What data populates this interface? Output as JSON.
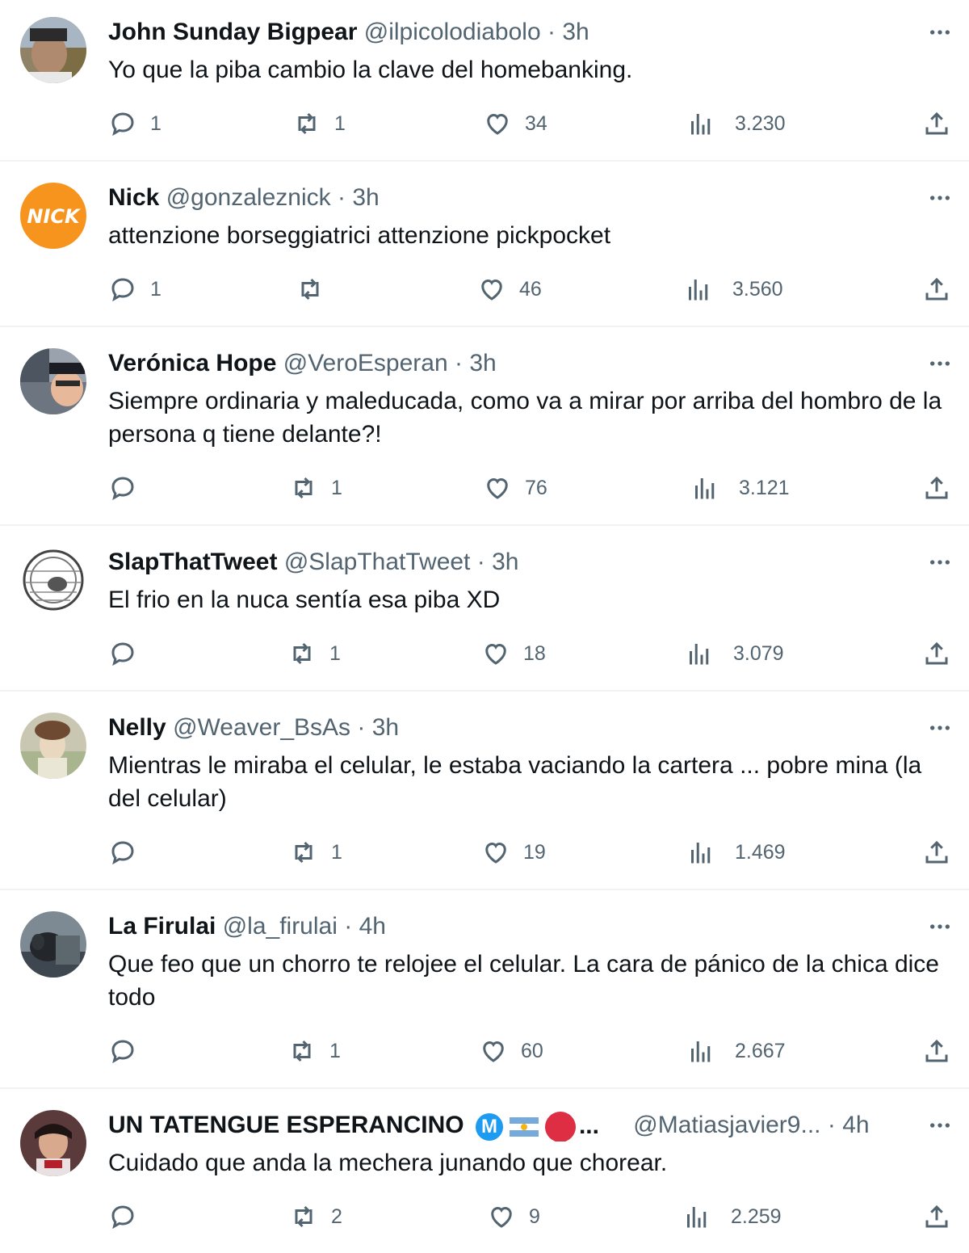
{
  "tweets": [
    {
      "name": "John Sunday Bigpear",
      "handle": "@ilpicolodiabolo",
      "sep": "·",
      "time": "3h",
      "text": "Yo que la piba cambio la clave del homebanking.",
      "replies": "1",
      "retweets": "1",
      "likes": "34",
      "views": "3.230",
      "avatar_icon": "user-photo-avatar"
    },
    {
      "name": "Nick",
      "handle": "@gonzaleznick",
      "sep": "·",
      "time": "3h",
      "text": "attenzione borseggiatrici attenzione pickpocket",
      "replies": "1",
      "retweets": "",
      "likes": "46",
      "views": "3.560",
      "avatar_text": "NICK",
      "avatar_color": "#f7941d"
    },
    {
      "name": "Verónica Hope",
      "handle": "@VeroEsperan",
      "sep": "·",
      "time": "3h",
      "text": "Siempre ordinaria y maleducada, como va a mirar por arriba del hombro de la persona q tiene delante?!",
      "replies": "",
      "retweets": "1",
      "likes": "76",
      "views": "3.121",
      "avatar_icon": "user-photo-avatar"
    },
    {
      "name": "SlapThatTweet",
      "handle": "@SlapThatTweet",
      "sep": "·",
      "time": "3h",
      "text": "El frio en la nuca sentía esa piba XD",
      "replies": "",
      "retweets": "1",
      "likes": "18",
      "views": "3.079",
      "avatar_icon": "hamster-wheel-avatar"
    },
    {
      "name": "Nelly",
      "handle": "@Weaver_BsAs",
      "sep": "·",
      "time": "3h",
      "text": "Mientras le miraba el celular, le estaba vaciando la cartera ... pobre mina (la del celular)",
      "replies": "",
      "retweets": "1",
      "likes": "19",
      "views": "1.469",
      "avatar_icon": "vintage-portrait-avatar"
    },
    {
      "name": "La Firulai",
      "handle": "@la_firulai",
      "sep": "·",
      "time": "4h",
      "text": "Que feo que un chorro te relojee el celular. La cara de pánico de la chica dice todo",
      "replies": "",
      "retweets": "1",
      "likes": "60",
      "views": "2.667",
      "avatar_icon": "dog-photo-avatar"
    },
    {
      "name": "UN TATENGUE ESPERANCINO",
      "handle": "@Matiasjavier9...",
      "sep": "·",
      "time": "4h",
      "text": "Cuidado que anda la mechera junando que chorear.",
      "replies": "",
      "retweets": "2",
      "likes": "9",
      "views": "2.259",
      "badge_m": "M",
      "name_ellipsis": "...",
      "avatar_icon": "user-photo-avatar"
    }
  ],
  "colors": {
    "text": "#0f1419",
    "secondary": "#536471",
    "divider": "#eff3f4",
    "verified_blue": "#1d9bf0"
  }
}
